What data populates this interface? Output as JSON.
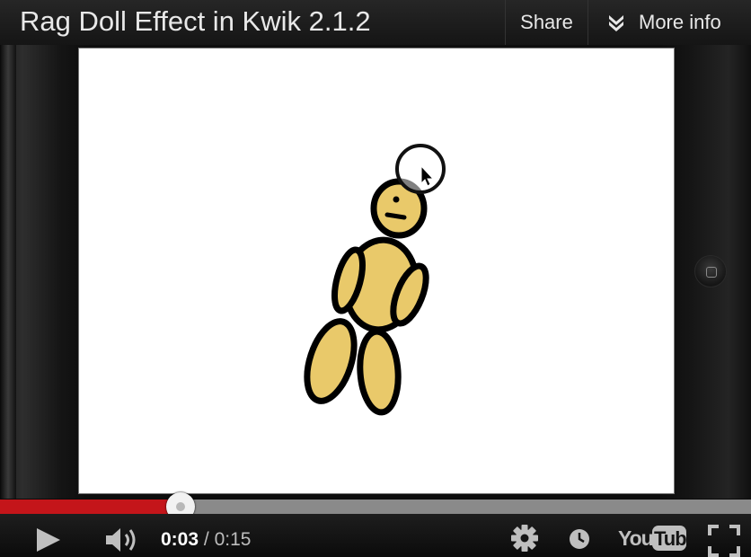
{
  "video": {
    "title": "Rag Doll Effect in Kwik 2.1.2",
    "share_label": "Share",
    "more_info_label": "More info"
  },
  "player": {
    "current_time": "0:03",
    "separator": "/",
    "duration": "0:15",
    "progress": 0.24,
    "logo_text": "YouTube"
  },
  "icons": {
    "more_info": "double-chevron-down-icon",
    "play": "play-icon",
    "volume": "volume-icon",
    "settings": "gear-icon",
    "watch_later": "clock-icon",
    "logo": "youtube-logo",
    "fullscreen": "fullscreen-icon",
    "cursor": "mouse-cursor-icon"
  },
  "colors": {
    "progress": "#c4151a",
    "doll_fill": "#e9c96a"
  }
}
